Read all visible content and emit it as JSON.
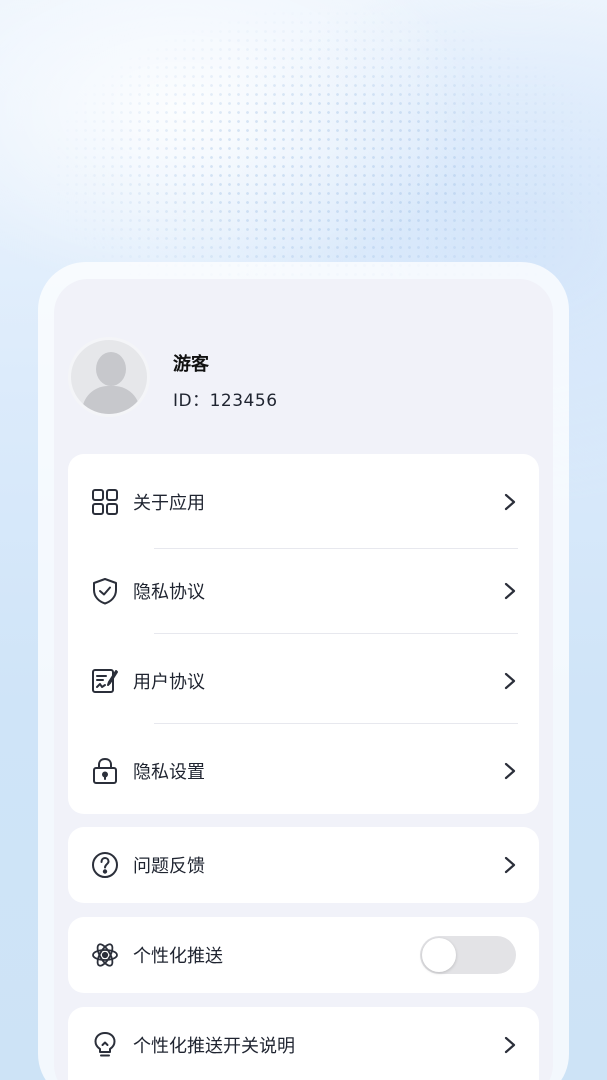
{
  "profile": {
    "name": "游客",
    "id_label": "ID：",
    "id_value": "123456"
  },
  "menu_main": [
    {
      "label": "关于应用",
      "icon": "grid-apps-icon"
    },
    {
      "label": "隐私协议",
      "icon": "shield-check-icon"
    },
    {
      "label": "用户协议",
      "icon": "document-sign-icon"
    },
    {
      "label": "隐私设置",
      "icon": "lock-icon"
    }
  ],
  "feedback": {
    "label": "问题反馈",
    "icon": "question-circle-icon"
  },
  "personalized_push": {
    "label": "个性化推送",
    "icon": "atom-icon",
    "enabled": false
  },
  "push_explanation": {
    "label": "个性化推送开关说明",
    "icon": "lightbulb-icon"
  },
  "colors": {
    "card": "#ffffff",
    "card_inner_bg": "#f1f2f9",
    "text": "#1f2430",
    "toggle_off": "#e3e3e6",
    "icon_stroke": "#2b2f3a"
  }
}
